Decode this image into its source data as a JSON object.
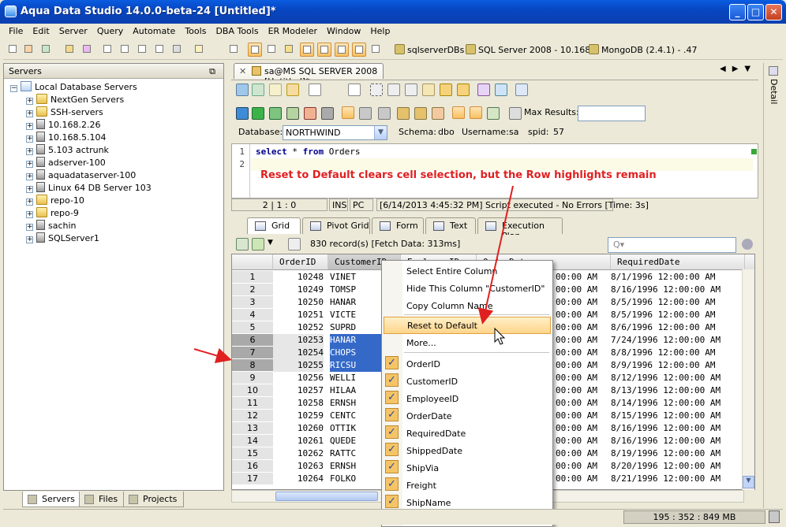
{
  "window": {
    "title": "Aqua Data Studio 14.0.0-beta-24 [Untitled]*"
  },
  "menu": [
    "File",
    "Edit",
    "Server",
    "Query",
    "Automate",
    "Tools",
    "DBA Tools",
    "ER Modeler",
    "Window",
    "Help"
  ],
  "connections": [
    {
      "label": "sqlserverDBs"
    },
    {
      "label": "SQL Server 2008 - 10.168."
    },
    {
      "label": "MongoDB (2.4.1) - .47"
    }
  ],
  "servers_panel": {
    "title": "Servers",
    "root": "Local Database Servers",
    "items": [
      "NextGen Servers",
      "SSH-servers",
      "10.168.2.26",
      "10.168.5.104",
      "5.103 actrunk",
      "adserver-100",
      "aquadataserver-100",
      "Linux 64 DB Server 103",
      "repo-10",
      "repo-9",
      "sachin",
      "SQLServer1"
    ],
    "tabs": [
      "Servers",
      "Files",
      "Projects"
    ]
  },
  "doc_tab": "sa@MS SQL SERVER 2008 [Untitled]*",
  "query": {
    "max_results_label": "Max Results:",
    "max_results_value": "",
    "database_label": "Database:",
    "database": "NORTHWIND",
    "schema_label": "Schema:",
    "schema": "dbo",
    "username_label": "Username:",
    "username": "sa",
    "spid_label": "spid:",
    "spid": "57",
    "line_numbers": [
      "1",
      "2"
    ],
    "sql_kw1": "select",
    "sql_mid": " * ",
    "sql_kw2": "from",
    "sql_table": " Orders"
  },
  "annotation": "Reset to Default clears cell selection, but the Row highlights remain",
  "status_line": {
    "position": "2 | 1 : 0",
    "ins": "INS",
    "pc": "PC",
    "message": "[6/14/2013 4:45:32 PM] Script executed - No Errors [Time: 3s]"
  },
  "result_tabs": [
    "Grid",
    "Pivot Grid",
    "Form",
    "Text",
    "Execution Plan"
  ],
  "grid_toolbar": {
    "records": "830 record(s) [Fetch Data: 313ms]",
    "search_placeholder": "Q▾"
  },
  "grid": {
    "columns": [
      "OrderID",
      "CustomerID",
      "EmployeeID",
      "OrderDate",
      "RequiredDate"
    ],
    "col_visible": [
      "OrderID",
      "CustomerID",
      "EmployeeID",
      "OrderDate",
      "RequiredDate"
    ],
    "row_numbers": [
      "1",
      "2",
      "3",
      "4",
      "5",
      "6",
      "7",
      "8",
      "9",
      "10",
      "11",
      "12",
      "13",
      "14",
      "15",
      "16",
      "17"
    ],
    "rows": [
      {
        "id": "10248",
        "cust": "VINET",
        "od_tail": "00:00 AM",
        "req": "8/1/1996 12:00:00 AM"
      },
      {
        "id": "10249",
        "cust": "TOMSP",
        "od_tail": "00:00 AM",
        "req": "8/16/1996 12:00:00 AM"
      },
      {
        "id": "10250",
        "cust": "HANAR",
        "od_tail": "00:00 AM",
        "req": "8/5/1996 12:00:00 AM"
      },
      {
        "id": "10251",
        "cust": "VICTE",
        "od_tail": "00:00 AM",
        "req": "8/5/1996 12:00:00 AM"
      },
      {
        "id": "10252",
        "cust": "SUPRD",
        "od_tail": "00:00 AM",
        "req": "8/6/1996 12:00:00 AM"
      },
      {
        "id": "10253",
        "cust": "HANAR",
        "od_tail": "00:00 AM",
        "req": "7/24/1996 12:00:00 AM"
      },
      {
        "id": "10254",
        "cust": "CHOPS",
        "od_tail": "00:00 AM",
        "req": "8/8/1996 12:00:00 AM"
      },
      {
        "id": "10255",
        "cust": "RICSU",
        "od_tail": "00:00 AM",
        "req": "8/9/1996 12:00:00 AM"
      },
      {
        "id": "10256",
        "cust": "WELLI",
        "od_tail": "00:00 AM",
        "req": "8/12/1996 12:00:00 AM"
      },
      {
        "id": "10257",
        "cust": "HILAA",
        "od_tail": "00:00 AM",
        "req": "8/13/1996 12:00:00 AM"
      },
      {
        "id": "10258",
        "cust": "ERNSH",
        "od_tail": "00:00 AM",
        "req": "8/14/1996 12:00:00 AM"
      },
      {
        "id": "10259",
        "cust": "CENTC",
        "od_tail": "00:00 AM",
        "req": "8/15/1996 12:00:00 AM"
      },
      {
        "id": "10260",
        "cust": "OTTIK",
        "od_tail": "00:00 AM",
        "req": "8/16/1996 12:00:00 AM"
      },
      {
        "id": "10261",
        "cust": "QUEDE",
        "od_tail": "00:00 AM",
        "req": "8/16/1996 12:00:00 AM"
      },
      {
        "id": "10262",
        "cust": "RATTC",
        "od_tail": "00:00 AM",
        "req": "8/19/1996 12:00:00 AM"
      },
      {
        "id": "10263",
        "cust": "ERNSH",
        "od_tail": "00:00 AM",
        "req": "8/20/1996 12:00:00 AM"
      },
      {
        "id": "10264",
        "cust": "FOLKO",
        "od_tail": "00:00 AM",
        "req": "8/21/1996 12:00:00 AM"
      }
    ]
  },
  "context_menu": {
    "items": [
      "Select Entire Column",
      "Hide This Column \"CustomerID\"",
      "Copy Column Name",
      "Reset to Default",
      "More..."
    ],
    "column_toggles": [
      "OrderID",
      "CustomerID",
      "EmployeeID",
      "OrderDate",
      "RequiredDate",
      "ShippedDate",
      "ShipVia",
      "Freight",
      "ShipName"
    ]
  },
  "right_panel": {
    "label": "Detail"
  },
  "statusbar": {
    "memory": "195 : 352 : 849 MB"
  },
  "colors": {
    "accent": "#0a5ce0",
    "annotation": "#e02020",
    "selection": "#3569c8",
    "menu_hot": "#ffd58a"
  }
}
